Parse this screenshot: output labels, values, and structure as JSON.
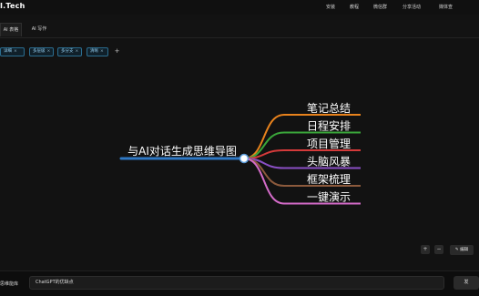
{
  "app": {
    "logo": "I.Tech"
  },
  "nav": [
    {
      "label": "安装"
    },
    {
      "label": "教程"
    },
    {
      "label": "微信群"
    },
    {
      "label": "分享活动"
    },
    {
      "label": "媒体查"
    }
  ],
  "tabs": [
    {
      "label": "AI 表格"
    },
    {
      "label": "AI 写作"
    }
  ],
  "tags": [
    {
      "label": "详细"
    },
    {
      "label": "多层级"
    },
    {
      "label": "多分支"
    },
    {
      "label": "清晰"
    }
  ],
  "add_tag": "+",
  "mindmap": {
    "root": "与AI对话生成思维导图",
    "root_line_color": "#2f78c4",
    "branches": [
      {
        "label": "笔记总结",
        "color": "#e8821c"
      },
      {
        "label": "日程安排",
        "color": "#3aa63a"
      },
      {
        "label": "项目管理",
        "color": "#d43a3a"
      },
      {
        "label": "头脑风暴",
        "color": "#8a4fc4"
      },
      {
        "label": "框架梳理",
        "color": "#8c5a3c"
      },
      {
        "label": "一键演示",
        "color": "#d36bc8"
      }
    ]
  },
  "toolbar": {
    "zoom_in": "+",
    "zoom_out": "−",
    "edit": "✎ 编辑"
  },
  "bottom": {
    "left_label": "思维能库",
    "input_value": "ChatGPT的优缺点",
    "send_label": "发"
  }
}
